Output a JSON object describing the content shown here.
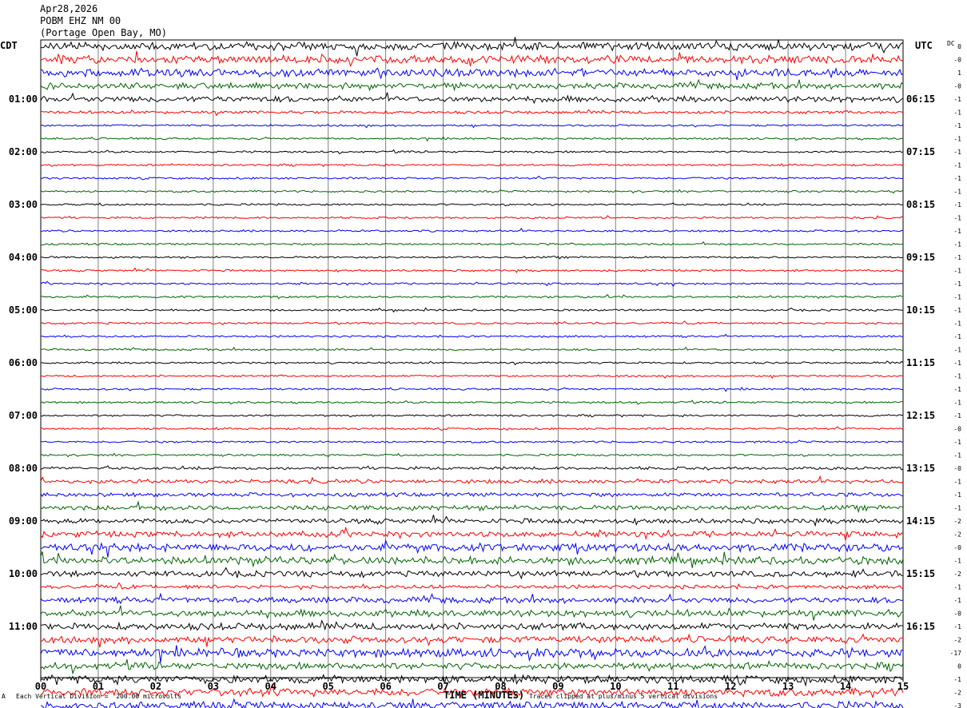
{
  "header": {
    "date": "Apr28,2026",
    "station": "POBM EHZ NM 00",
    "location": "(Portage Open Bay, MO)"
  },
  "left_tz": "CDT",
  "right_tz": "UTC",
  "dc_label": "DC",
  "footer": {
    "mark": "A",
    "scale": "Each Vertical Division =  200.00 microvolts",
    "clip": "Traces clipped at plus/minus 5 vertical divisions"
  },
  "chart_data": {
    "type": "helicorder",
    "xlabel": "TIME (MINUTES)",
    "xlim": [
      0,
      15
    ],
    "x_ticks": [
      "00",
      "01",
      "02",
      "03",
      "04",
      "05",
      "06",
      "07",
      "08",
      "09",
      "10",
      "11",
      "12",
      "13",
      "14",
      "15"
    ],
    "trace_colors": [
      "#000000",
      "#ff0000",
      "#0000ff",
      "#006400"
    ],
    "left_hour_labels": [
      "01:00",
      "02:00",
      "03:00",
      "04:00",
      "05:00",
      "06:00",
      "07:00",
      "08:00",
      "09:00",
      "10:00",
      "11:00"
    ],
    "right_hour_labels": [
      "06:15",
      "07:15",
      "08:15",
      "09:15",
      "10:15",
      "11:15",
      "12:15",
      "13:15",
      "14:15",
      "15:15",
      "16:15"
    ],
    "dc_offsets": [
      "0",
      "-0",
      "1",
      "-0",
      "-1",
      "-1",
      "-1",
      "-1",
      "-1",
      "-1",
      "-1",
      "-1",
      "-1",
      "-1",
      "-1",
      "-1",
      "-1",
      "-1",
      "-1",
      "-1",
      "-1",
      "-1",
      "-1",
      "-1",
      "-1",
      "-1",
      "-1",
      "-1",
      "-1",
      "-0",
      "-1",
      "-1",
      "-0",
      "-1",
      "-1",
      "-1",
      "-2",
      "-2",
      "-0",
      "-1",
      "-2",
      "-1",
      "-1",
      "-0",
      "-1",
      "-2",
      "-17",
      "0",
      "-1",
      "-2",
      "-3",
      "-4"
    ],
    "trace_activity": [
      4,
      4,
      4,
      3,
      3,
      1.5,
      1,
      1,
      1,
      1,
      1,
      1,
      1,
      1,
      1,
      1,
      1,
      1,
      1,
      1,
      1,
      1,
      1,
      1,
      1,
      1,
      1,
      1,
      1,
      1,
      1,
      1,
      1.5,
      2,
      2,
      2.5,
      2.5,
      3,
      4,
      4,
      3,
      2,
      3,
      3.5,
      3.5,
      3.5,
      4.5,
      3.5,
      4,
      4,
      4,
      3
    ]
  }
}
